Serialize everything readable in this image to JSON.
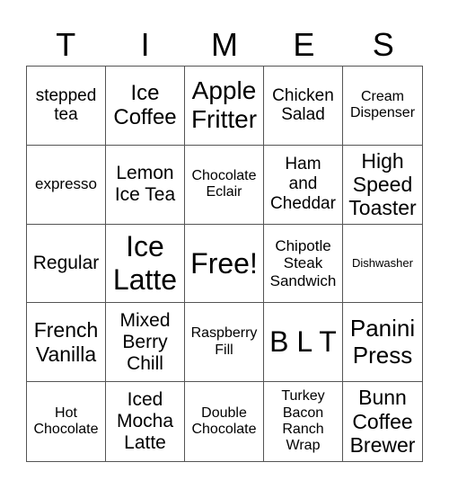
{
  "header": {
    "letters": [
      "T",
      "I",
      "M",
      "E",
      "S"
    ]
  },
  "cells": [
    [
      "stepped\ntea",
      "Ice\nCoffee",
      "Apple\nFritter",
      "Chicken\nSalad",
      "Cream\nDispenser"
    ],
    [
      "expresso",
      "Lemon\nIce Tea",
      "Chocolate\nEclair",
      "Ham\nand\nCheddar",
      "High\nSpeed\nToaster"
    ],
    [
      "Regular",
      "Ice\nLatte",
      "Free!",
      "Chipotle\nSteak\nSandwich",
      "Dishwasher"
    ],
    [
      "French\nVanilla",
      "Mixed\nBerry\nChill",
      "Raspberry\nFill",
      "B L T",
      "Panini\nPress"
    ],
    [
      "Hot\nChocolate",
      "Iced\nMocha\nLatte",
      "Double\nChocolate",
      "Turkey\nBacon\nRanch\nWrap",
      "Bunn\nCoffee\nBrewer"
    ]
  ]
}
